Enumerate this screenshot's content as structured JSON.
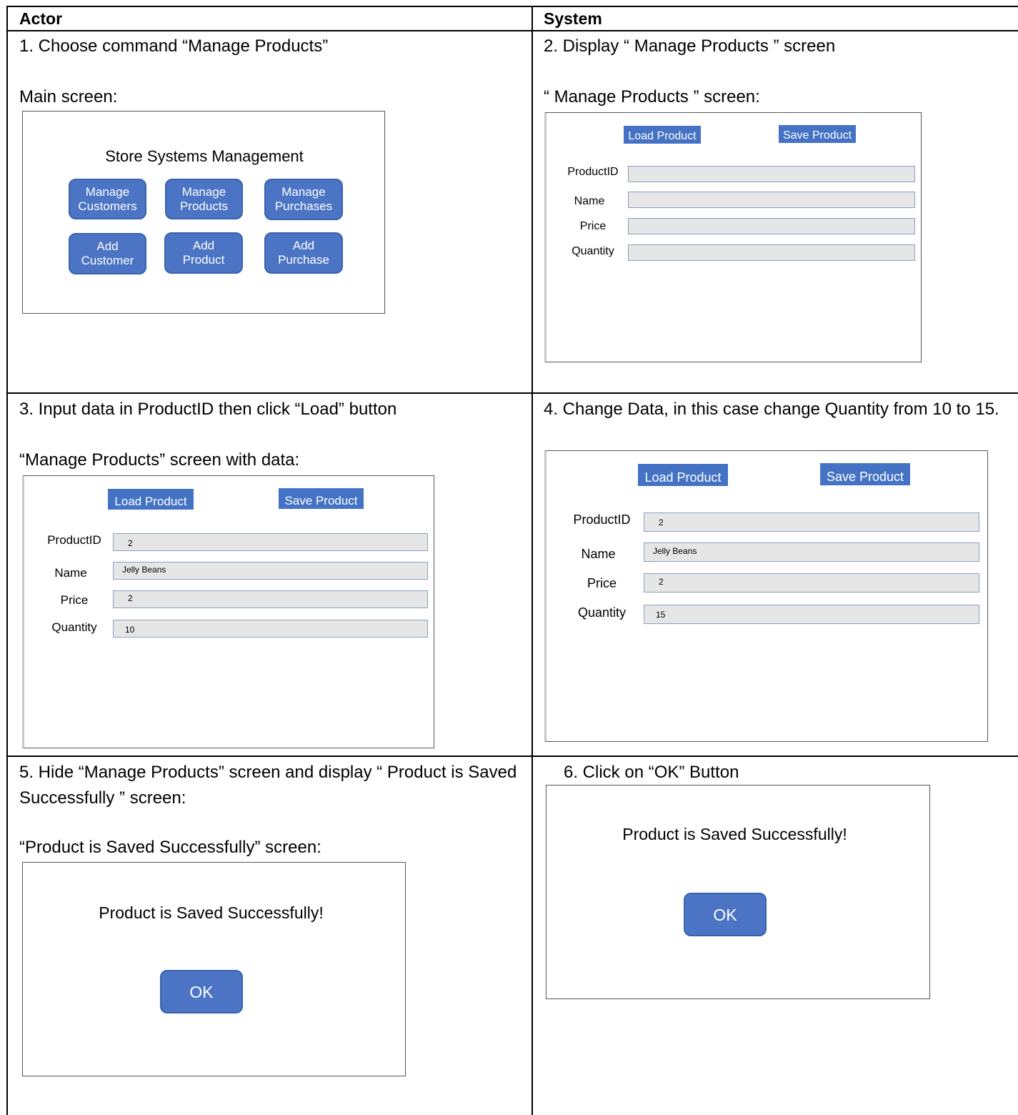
{
  "table": {
    "header_actor": "Actor",
    "header_system": "System"
  },
  "steps": {
    "s1": "1. Choose command “Manage Products”",
    "s1_caption": "Main screen:",
    "s2": "2. Display “ Manage Products ” screen",
    "s2_caption": "“ Manage Products ” screen:",
    "s3": "3. Input data in ProductID then click “Load” button",
    "s3_caption": "“Manage Products” screen with data:",
    "s4": "4. Change Data, in this case change Quantity from 10 to 15.",
    "s5": "5. Hide “Manage Products” screen and display “ Product is Saved Successfully ” screen:",
    "s5_caption": "“Product is Saved Successfully” screen:",
    "s6": "6. Click on “OK” Button"
  },
  "main_screen": {
    "title": "Store Systems Management",
    "buttons": {
      "manage_customers": "Manage\nCustomers",
      "manage_products": "Manage\nProducts",
      "manage_purchases": "Manage\nPurchases",
      "add_customer": "Add\nCustomer",
      "add_product": "Add\nProduct",
      "add_purchase": "Add\nPurchase"
    }
  },
  "manage_products": {
    "load_label": "Load Product",
    "save_label": "Save Product",
    "field_labels": {
      "product_id": "ProductID",
      "name": "Name",
      "price": "Price",
      "quantity": "Quantity"
    },
    "with_data": {
      "product_id": "2",
      "name": "Jelly Beans",
      "price": "2",
      "quantity": "10"
    },
    "changed": {
      "product_id": "2",
      "name": "Jelly Beans",
      "price": "2",
      "quantity": "15"
    }
  },
  "saved_dialog": {
    "message": "Product is Saved Successfully!",
    "ok_label": "OK"
  },
  "colors": {
    "button_blue": "#4b74c4",
    "field_gray": "#e6e6e6"
  }
}
